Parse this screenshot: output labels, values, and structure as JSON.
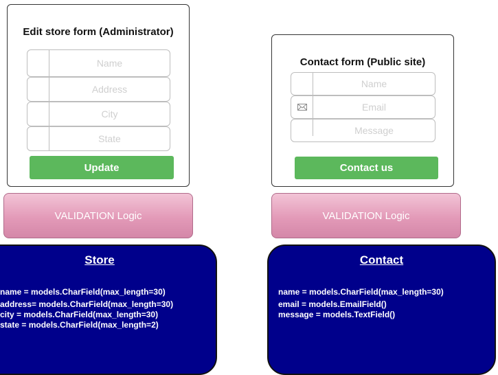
{
  "store_form": {
    "title": "Edit store form (Administrator)",
    "fields": [
      {
        "placeholder": "Name"
      },
      {
        "placeholder": "Address"
      },
      {
        "placeholder": "City"
      },
      {
        "placeholder": "State"
      }
    ],
    "button_label": "Update"
  },
  "contact_form": {
    "title": "Contact form (Public site)",
    "fields": [
      {
        "placeholder": "Name",
        "icon": "none"
      },
      {
        "placeholder": "Email",
        "icon": "envelope-icon"
      },
      {
        "placeholder": "Message",
        "icon": "none"
      }
    ],
    "button_label": "Contact us"
  },
  "validation_left": {
    "label": "VALIDATION Logic"
  },
  "validation_right": {
    "label": "VALIDATION Logic"
  },
  "store_model": {
    "title": "Store",
    "lines": [
      "name = models.CharField(max_length=30)",
      "address= models.CharField(max_length=30)",
      "city = models.CharField(max_length=30)",
      "state = models.CharField(max_length=2)"
    ]
  },
  "contact_model": {
    "title": "Contact",
    "lines": [
      "name = models.CharField(max_length=30)",
      "email = models.EmailField()",
      "message = models.TextField()"
    ]
  },
  "colors": {
    "button_green": "#5cb85c",
    "validation_pink": "#e39ab8",
    "model_navy": "#00008b"
  }
}
